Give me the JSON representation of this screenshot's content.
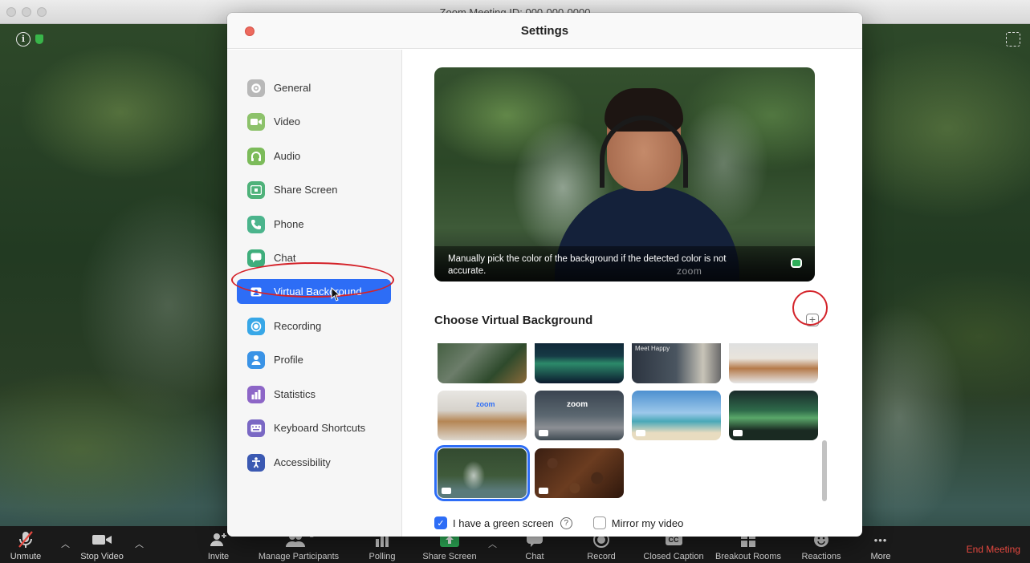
{
  "window": {
    "title": "Zoom Meeting ID: 000-000-0000"
  },
  "settings": {
    "title": "Settings",
    "nav": [
      {
        "label": "General",
        "icon": "gear-icon",
        "color": "#b8b8b8"
      },
      {
        "label": "Video",
        "icon": "video-camera-icon",
        "color": "#8dc26b"
      },
      {
        "label": "Audio",
        "icon": "headphones-icon",
        "color": "#7cbb5a"
      },
      {
        "label": "Share Screen",
        "icon": "share-screen-icon",
        "color": "#4fb27a"
      },
      {
        "label": "Phone",
        "icon": "phone-icon",
        "color": "#4bb48c"
      },
      {
        "label": "Chat",
        "icon": "chat-bubble-icon",
        "color": "#3fae7c"
      },
      {
        "label": "Virtual Background",
        "icon": "person-portrait-icon",
        "color": "#2d6df6",
        "active": true
      },
      {
        "label": "Recording",
        "icon": "record-icon",
        "color": "#38a7e7"
      },
      {
        "label": "Profile",
        "icon": "profile-icon",
        "color": "#3a93e6"
      },
      {
        "label": "Statistics",
        "icon": "statistics-icon",
        "color": "#8d66c7"
      },
      {
        "label": "Keyboard Shortcuts",
        "icon": "keyboard-icon",
        "color": "#7a68c4"
      },
      {
        "label": "Accessibility",
        "icon": "accessibility-icon",
        "color": "#3b59b2"
      }
    ],
    "preview": {
      "caption": "Manually pick the color of the background if the detected color is not accurate.",
      "watermark": "zoom"
    },
    "choose_title": "Choose Virtual Background",
    "green_screen_label": "I have a green screen",
    "mirror_label": "Mirror my video",
    "green_screen_checked": true,
    "mirror_checked": false,
    "thumb_sign_text": "Meet Happy",
    "thumb_logo_text": "zoom"
  },
  "toolbar": {
    "items": [
      {
        "label": "Unmute",
        "icon": "muted-microphone-icon"
      },
      {
        "label": "Stop Video",
        "icon": "video-camera-icon"
      },
      {
        "label": "Invite",
        "icon": "invite-icon"
      },
      {
        "label": "Manage Participants",
        "icon": "participants-icon",
        "badge": "1"
      },
      {
        "label": "Polling",
        "icon": "polling-icon"
      },
      {
        "label": "Share Screen",
        "icon": "share-screen-icon"
      },
      {
        "label": "Chat",
        "icon": "chat-bubble-icon"
      },
      {
        "label": "Record",
        "icon": "record-icon"
      },
      {
        "label": "Closed Caption",
        "icon": "closed-caption-icon"
      },
      {
        "label": "Breakout Rooms",
        "icon": "breakout-rooms-icon"
      },
      {
        "label": "Reactions",
        "icon": "reactions-icon"
      },
      {
        "label": "More",
        "icon": "more-icon"
      }
    ],
    "end_label": "End Meeting",
    "cc_text": "CC",
    "more_text": "•••"
  },
  "colors": {
    "accent": "#2d6df6",
    "end_meeting": "#e5483f",
    "annotation": "#d4232a"
  }
}
